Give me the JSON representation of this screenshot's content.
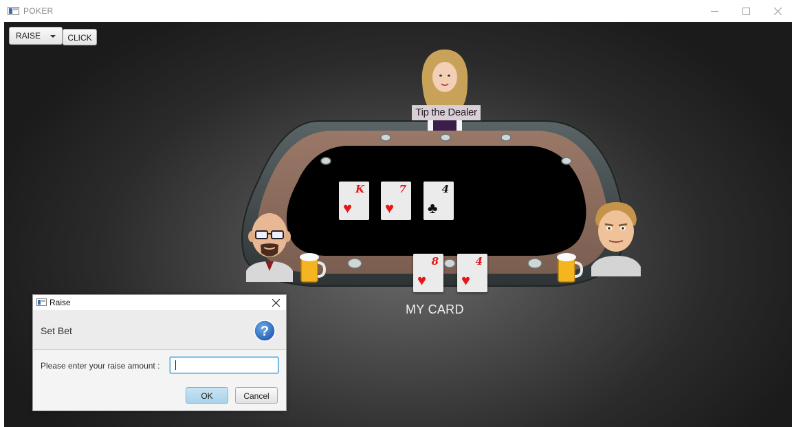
{
  "window": {
    "title": "POKER",
    "icon": "app-window-icon",
    "controls": [
      "minimize-icon",
      "maximize-icon",
      "close-icon"
    ]
  },
  "toolbar": {
    "action_select_value": "RAISE",
    "click_label": "CLICK"
  },
  "dealer": {
    "tip_label": "Tip the Dealer"
  },
  "community_cards": [
    {
      "rank": "K",
      "suit": "♥",
      "color": "#e41717"
    },
    {
      "rank": "7",
      "suit": "♥",
      "color": "#e41717"
    },
    {
      "rank": "4",
      "suit": "♣",
      "color": "#111111"
    }
  ],
  "my_cards": [
    {
      "rank": "8",
      "suit": "♥",
      "color": "#e41717"
    },
    {
      "rank": "4",
      "suit": "♥",
      "color": "#e41717"
    }
  ],
  "my_card_label": "MY CARD",
  "dialog": {
    "title": "Raise",
    "header": "Set Bet",
    "prompt": "Please enter your raise amount :",
    "input_value": "",
    "ok_label": "OK",
    "cancel_label": "Cancel"
  },
  "colors": {
    "table_felt": "#000000",
    "table_rail": "#8a6a5a",
    "card_red": "#e41717",
    "accent": "#3c9ad3"
  }
}
